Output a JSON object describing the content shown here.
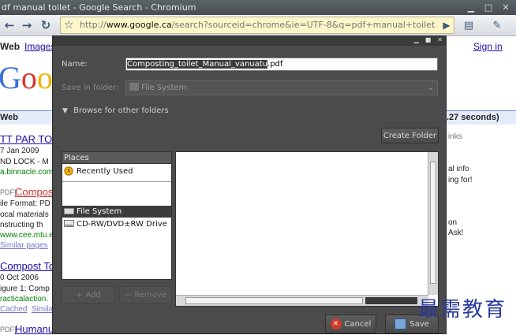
{
  "window": {
    "title": "df manual toilet - Google Search - Chromium"
  },
  "toolbar": {
    "url_prefix": "http://",
    "url_host": "www.google.ca",
    "url_path": "/search?sourceid=chrome&ie=UTF-8&q=pdf+manual+toilet"
  },
  "page": {
    "nav_web": "Web",
    "nav_images": "Images",
    "sign_in": "Sign in",
    "logo_fragment": "Goo",
    "results_bar_label": "Web",
    "results_time": ".27 seconds)",
    "right_fragments": [
      "inks",
      "al info",
      "ing for!",
      "on",
      "Ask!"
    ],
    "results": [
      {
        "title": "TT PAR TOI",
        "date": "7 Jan 2009",
        "snippet": "ND LOCK - M",
        "url": "a.binnacle.com"
      },
      {
        "tag": "PDF]",
        "title": "Compos",
        "format": "ile Format: PD",
        "snippet1": "ocal materials",
        "snippet2": "nstructing th",
        "url": "www.cee.mtu.e",
        "similar": "Similar pages"
      },
      {
        "title": "Compost To",
        "date": "0 Oct 2006",
        "snippet": "igure 1: Comp",
        "url": "racticalaction.",
        "cached": "Cached",
        "similar": "Simila"
      },
      {
        "tag": "PDF]",
        "title": "Humanu"
      }
    ]
  },
  "dialog": {
    "name_label": "Name:",
    "filename_selected": "Composting_toilet_Manual_vanuatu",
    "filename_ext": ".pdf",
    "save_in_label": "Save in folder:",
    "save_in_value": "File System",
    "browse_label": "Browse for other folders",
    "create_folder": "Create Folder",
    "places_header": "Places",
    "places": [
      {
        "label": "Recently Used",
        "icon": "recent-icon"
      },
      {
        "label": "File System",
        "icon": "drive-icon"
      },
      {
        "label": "CD-RW/DVD±RW Drive",
        "icon": "optical-drive-icon"
      }
    ],
    "add_button": "Add",
    "remove_button": "Remove",
    "cancel_button": "Cancel",
    "save_button": "Save"
  },
  "watermark": "最需教育"
}
